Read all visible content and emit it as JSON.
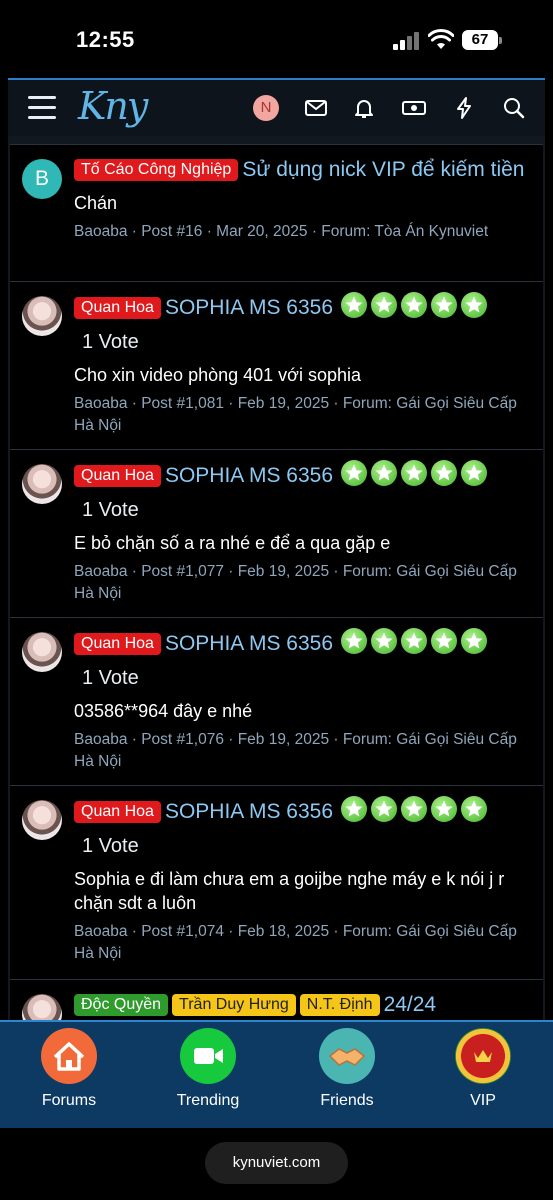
{
  "status_bar": {
    "time": "12:55",
    "battery": "67"
  },
  "header": {
    "logo": "Kny",
    "avatar_initial": "N"
  },
  "posts": [
    {
      "avatar_initial": "B",
      "badges": [
        "Tố Cáo Công Nghiệp"
      ],
      "title": "Sử dụng nick VIP để kiếm tiền",
      "vote": "",
      "snippet": "Chán",
      "meta": "Baoaba · Post #16 · Mar 20, 2025 · Forum: Tòa Án Kynuviet"
    },
    {
      "badges": [
        "Quan Hoa"
      ],
      "title": "SOPHIA MS 6356",
      "vote": "1 Vote",
      "rating": 5,
      "snippet": "Cho xin video phòng 401 với sophia",
      "meta": "Baoaba · Post #1,081 · Feb 19, 2025 · Forum: Gái Gọi Siêu Cấp Hà Nội"
    },
    {
      "badges": [
        "Quan Hoa"
      ],
      "title": "SOPHIA MS 6356",
      "vote": "1 Vote",
      "rating": 5,
      "snippet": "E bỏ chặn số a ra nhé e để a qua gặp e",
      "meta": "Baoaba · Post #1,077 · Feb 19, 2025 · Forum: Gái Gọi Siêu Cấp Hà Nội"
    },
    {
      "badges": [
        "Quan Hoa"
      ],
      "title": "SOPHIA MS 6356",
      "vote": "1 Vote",
      "rating": 5,
      "snippet": "03586**964 đây e nhé",
      "meta": "Baoaba · Post #1,076 · Feb 19, 2025 · Forum: Gái Gọi Siêu Cấp Hà Nội"
    },
    {
      "badges": [
        "Quan Hoa"
      ],
      "title": "SOPHIA MS 6356",
      "vote": "1 Vote",
      "rating": 5,
      "snippet": "Sophia e đi làm chưa em a goijbe nghe máy e k nói j r chặn sdt a luôn",
      "meta": "Baoaba · Post #1,074 · Feb 18, 2025 · Forum: Gái Gọi Siêu Cấp Hà Nội"
    },
    {
      "badges": [
        "Độc Quyền",
        "Trần Duy Hưng",
        "N.T. Định"
      ],
      "title": "24/24",
      "vote": "",
      "snippet": "",
      "meta": ""
    }
  ],
  "bottom_nav": [
    {
      "label": "Forums",
      "icon": "home-icon"
    },
    {
      "label": "Trending",
      "icon": "video-camera-icon"
    },
    {
      "label": "Friends",
      "icon": "handshake-icon"
    },
    {
      "label": "VIP",
      "icon": "vip-emblem-icon"
    }
  ],
  "url_bar": {
    "domain": "kynuviet.com"
  },
  "colors": {
    "badge_red": "#e0191c",
    "badge_green": "#2e9b2c",
    "badge_yellow": "#f5c518",
    "title_blue": "#8cc8f2",
    "nav_bg": "#0c3a63"
  }
}
